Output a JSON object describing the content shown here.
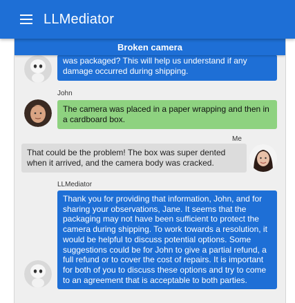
{
  "app": {
    "title": "LLMediator"
  },
  "conversation": {
    "title": "Broken camera",
    "messages": [
      {
        "sender": "LLMediator",
        "text": "was packaged? This will help us understand if any damage occurred during shipping."
      },
      {
        "sender": "John",
        "text": "The camera was placed in a paper wrapping and then in a cardboard box."
      },
      {
        "sender": "Me",
        "text": "That could be the problem! The box was super dented when it arrived, and the camera body was cracked."
      },
      {
        "sender": "LLMediator",
        "text": "Thank you for providing that information, John, and for sharing your observations, Jane. It seems that the packaging may not have been sufficient to protect the camera during shipping. To work towards a resolution, it would be helpful to discuss potential options. Some suggestions could be for John to give a partial refund, a full refund or to cover the cost of repairs. It is important for both of you to discuss these options and try to come to an agreement that is acceptable to both parties."
      }
    ]
  },
  "colors": {
    "primary": "#1e6fd6",
    "mediator_bubble": "#1e6fd6",
    "john_bubble": "#8ed280",
    "me_bubble": "#dcdcdc",
    "panel_bg": "#efefef"
  },
  "icons": {
    "menu": "hamburger-menu-icon",
    "mediator_avatar": "robot-avatar",
    "john_avatar": "john-avatar",
    "me_avatar": "me-avatar"
  }
}
